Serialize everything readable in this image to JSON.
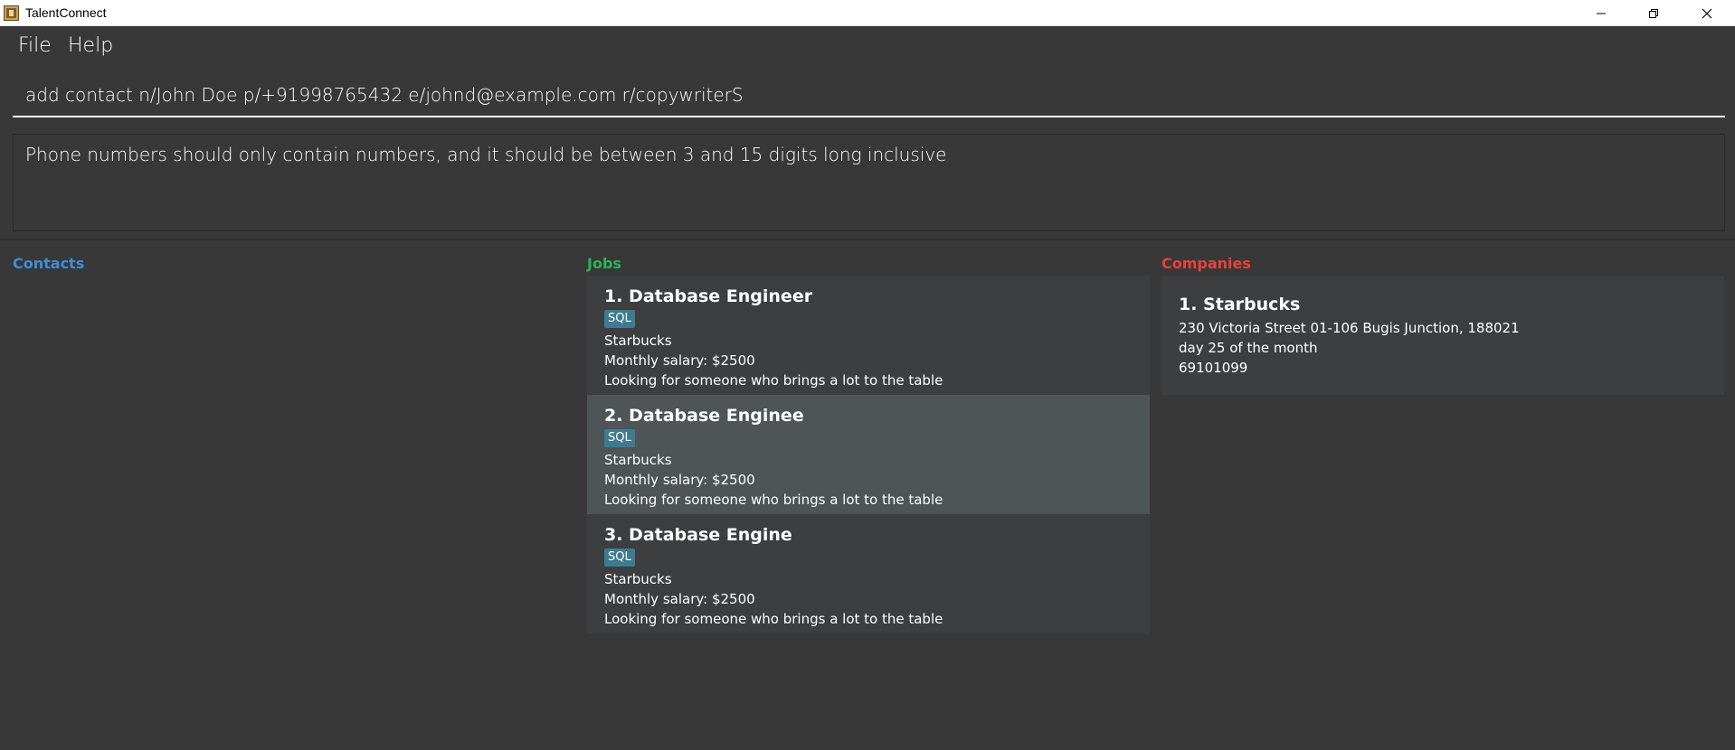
{
  "window": {
    "title": "TalentConnect"
  },
  "menu": {
    "file": "File",
    "help": "Help"
  },
  "command": {
    "value": "add contact n/John Doe p/+91998765432 e/johnd@example.com r/copywriterS"
  },
  "result": {
    "message": "Phone numbers should only contain numbers, and it should be between 3 and 15 digits long inclusive"
  },
  "panels": {
    "contacts": {
      "title": "Contacts",
      "items": []
    },
    "jobs": {
      "title": "Jobs",
      "items": [
        {
          "title": "1. Database Engineer",
          "tag": "SQL",
          "company": "Starbucks",
          "salary": "Monthly salary: $2500",
          "description": "Looking for someone who brings a lot to the table",
          "selected": false
        },
        {
          "title": "2. Database Enginee",
          "tag": "SQL",
          "company": "Starbucks",
          "salary": "Monthly salary: $2500",
          "description": "Looking for someone who brings a lot to the table",
          "selected": true
        },
        {
          "title": "3. Database Engine",
          "tag": "SQL",
          "company": "Starbucks",
          "salary": "Monthly salary: $2500",
          "description": "Looking for someone who brings a lot to the table",
          "selected": false
        }
      ]
    },
    "companies": {
      "title": "Companies",
      "items": [
        {
          "title": "1. Starbucks",
          "address": "230 Victoria Street 01-106 Bugis Junction, 188021",
          "billing": "day 25 of the month",
          "phone": "69101099"
        }
      ]
    }
  },
  "colors": {
    "background": "#383838",
    "contacts_header": "#3e8ed8",
    "jobs_header": "#2db35a",
    "companies_header": "#e8423a",
    "tag": "#3e7b91",
    "card": "#3c3e3f",
    "card_selected": "#4f5457"
  }
}
